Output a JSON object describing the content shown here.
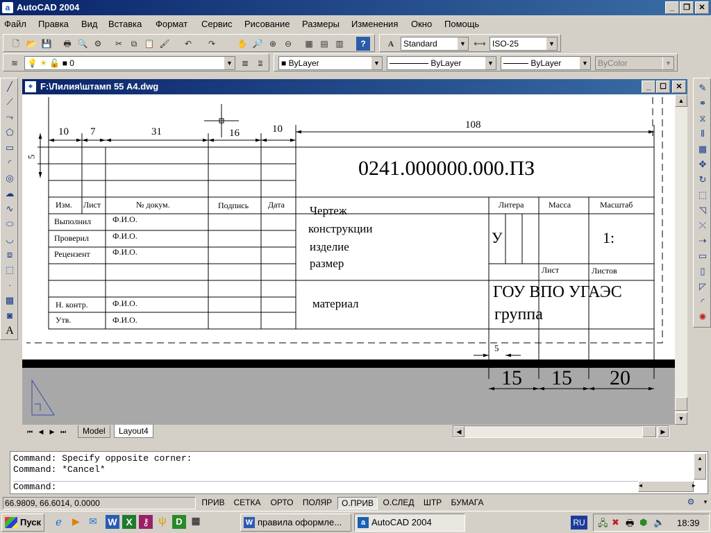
{
  "app": {
    "title": "AutoCAD 2004"
  },
  "menu": [
    "Файл",
    "Правка",
    "Вид",
    "Вставка",
    "Формат",
    "Сервис",
    "Рисование",
    "Размеры",
    "Изменения",
    "Окно",
    "Помощь"
  ],
  "toolbar": {
    "text_style": "Standard",
    "dim_style": "ISO-25",
    "layer": "0",
    "color": "ByLayer",
    "linetype": "ByLayer",
    "lineweight": "ByLayer",
    "plotstyle": "ByColor"
  },
  "drawing_window": {
    "title": "F:\\Лилия\\штамп 55 А4.dwg"
  },
  "stamp": {
    "dims_top": [
      "10",
      "7",
      "31",
      "16",
      "10",
      "108"
    ],
    "dim_left": "5",
    "doc_number": "0241.000000.000.ПЗ",
    "headers": [
      "Изм.",
      "Лист",
      "№ докум.",
      "Подпись",
      "Дата"
    ],
    "rows": [
      {
        "role": "Выполнил",
        "name": "Ф.И.О."
      },
      {
        "role": "Проверил",
        "name": "Ф.И.О."
      },
      {
        "role": "Рецензент",
        "name": "Ф.И.О."
      },
      {
        "role": "Н. контр.",
        "name": "Ф.И.О."
      },
      {
        "role": "Утв.",
        "name": "Ф.И.О."
      }
    ],
    "title_lines": [
      "Чертеж",
      "конструкции",
      "изделие",
      "размер"
    ],
    "material": "материал",
    "litera_label": "Литера",
    "massa_label": "Масса",
    "scale_label": "Масштаб",
    "litera_value": "У",
    "scale_value": "1:",
    "sheet_label": "Лист",
    "sheets_label": "Листов",
    "org": "ГОУ ВПО УГАЭС",
    "group": "группа",
    "dim_bottom_small": "5",
    "dims_bottom": [
      "15",
      "15",
      "20"
    ]
  },
  "tabs": [
    "Model",
    "Layout4"
  ],
  "command": {
    "lines": [
      "Command: Specify opposite corner:",
      "Command: *Cancel*"
    ],
    "prompt": "Command:"
  },
  "status": {
    "coords": "66.9809,  66.6014, 0.0000",
    "buttons": [
      {
        "label": "ПРИВ",
        "on": false
      },
      {
        "label": "СЕТКА",
        "on": false
      },
      {
        "label": "ОРТО",
        "on": false
      },
      {
        "label": "ПОЛЯР",
        "on": false
      },
      {
        "label": "О.ПРИВ",
        "on": true
      },
      {
        "label": "О.СЛЕД",
        "on": false
      },
      {
        "label": "ШТР",
        "on": false
      },
      {
        "label": "БУМАГА",
        "on": false
      }
    ]
  },
  "taskbar": {
    "start": "Пуск",
    "tasks": [
      "правила оформле...",
      "AutoCAD 2004"
    ],
    "lang": "RU",
    "clock": "18:39"
  }
}
